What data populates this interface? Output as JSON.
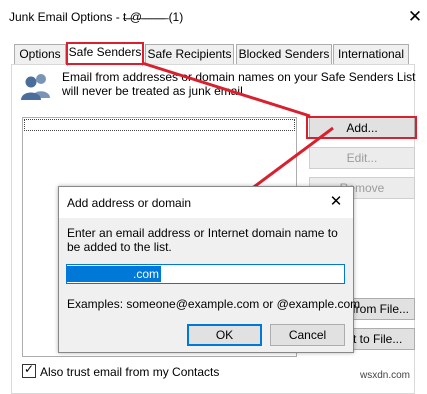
{
  "window": {
    "title": "Junk Email Options - t̶ ̶@̶ ̶ ̶ ̶ ̶ ̶ ̶ ̶ (1)",
    "close_glyph": "✕"
  },
  "tabs": [
    {
      "label": "Options"
    },
    {
      "label": "Safe Senders"
    },
    {
      "label": "Safe Recipients"
    },
    {
      "label": "Blocked Senders"
    },
    {
      "label": "International"
    }
  ],
  "safe_senders": {
    "description": "Email from addresses or domain names on your Safe Senders List will never be treated as junk email",
    "buttons": {
      "add": "Add...",
      "edit": "Edit...",
      "remove": "Remove",
      "import": "Import from File...",
      "export": "Export to File..."
    },
    "trust_contacts_label": "Also trust email from my Contacts",
    "trust_contacts_checked": true
  },
  "dialog": {
    "title": "Add address or domain",
    "close_glyph": "✕",
    "instruction": "Enter an email address or Internet domain name to be added to the list.",
    "input_value": ".com",
    "examples": "Examples: someone@example.com or @example.com",
    "ok_label": "OK",
    "cancel_label": "Cancel"
  },
  "watermark": "wsxdn.com",
  "colors": {
    "annotation_red": "#d9202e",
    "selection_blue": "#0078d7",
    "icon_blue": "#4a6d9c"
  },
  "icons": {
    "people": "people-icon",
    "check": "✓"
  }
}
